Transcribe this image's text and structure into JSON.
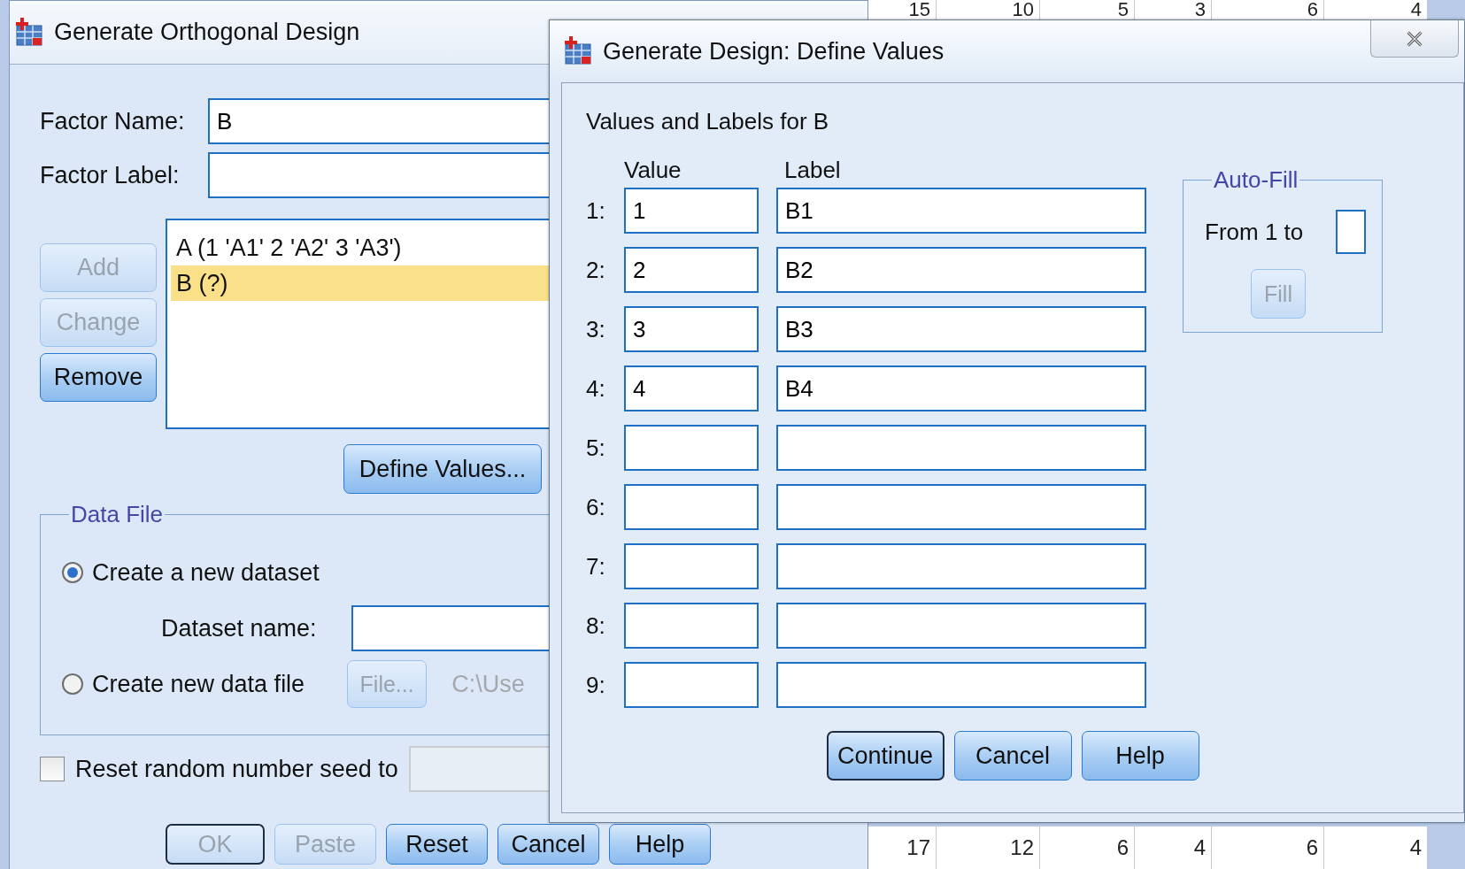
{
  "background_sheet": {
    "top_row": [
      "15",
      "10",
      "5",
      "3",
      "6",
      "4"
    ],
    "bottom_row": [
      "17",
      "12",
      "6",
      "4",
      "6",
      "4"
    ]
  },
  "main_dialog": {
    "title": "Generate Orthogonal Design",
    "factor_name": {
      "label": "Factor Name:",
      "value": "B"
    },
    "factor_label": {
      "label": "Factor Label:"
    },
    "factor_buttons": [
      {
        "label": "Add",
        "disabled": true
      },
      {
        "label": "Change",
        "disabled": true
      },
      {
        "label": "Remove",
        "disabled": false
      }
    ],
    "factors": [
      {
        "text": "A (1 'A1' 2 'A2' 3 'A3')",
        "selected": false
      },
      {
        "text": "B (?)",
        "selected": true
      }
    ],
    "define_values_button": "Define Values...",
    "data_file": {
      "title": "Data File",
      "options": [
        {
          "label": "Create a new dataset",
          "selected": true
        },
        {
          "label": "Create new data file",
          "selected": false
        }
      ],
      "dataset_name_label": "Dataset name:",
      "file_button": {
        "label": "File...",
        "disabled": true
      },
      "path": "C:\\Use"
    },
    "reset_seed": {
      "label": "Reset random number seed to",
      "checked": false
    },
    "buttons": [
      {
        "label": "OK",
        "disabled": true,
        "default": true
      },
      {
        "label": "Paste",
        "disabled": true,
        "default": false
      },
      {
        "label": "Reset",
        "disabled": false,
        "default": false
      },
      {
        "label": "Cancel",
        "disabled": false,
        "default": false
      },
      {
        "label": "Help",
        "disabled": false,
        "default": false
      }
    ]
  },
  "define_values_dialog": {
    "title": "Generate Design: Define Values",
    "heading": "Values and Labels for B",
    "columns": [
      "Value",
      "Label"
    ],
    "rows": [
      {
        "number": "1:",
        "value": "1",
        "label": "B1"
      },
      {
        "number": "2:",
        "value": "2",
        "label": "B2"
      },
      {
        "number": "3:",
        "value": "3",
        "label": "B3"
      },
      {
        "number": "4:",
        "value": "4",
        "label": "B4"
      },
      {
        "number": "5:"
      },
      {
        "number": "6:"
      },
      {
        "number": "7:"
      },
      {
        "number": "8:"
      },
      {
        "number": "9:"
      }
    ],
    "auto_fill": {
      "title": "Auto-Fill",
      "from_label": "From 1 to",
      "fill_button": {
        "label": "Fill",
        "disabled": true
      }
    },
    "buttons": [
      {
        "label": "Continue",
        "disabled": false,
        "default": true
      },
      {
        "label": "Cancel",
        "disabled": false,
        "default": false
      },
      {
        "label": "Help",
        "disabled": false,
        "default": false
      }
    ]
  }
}
